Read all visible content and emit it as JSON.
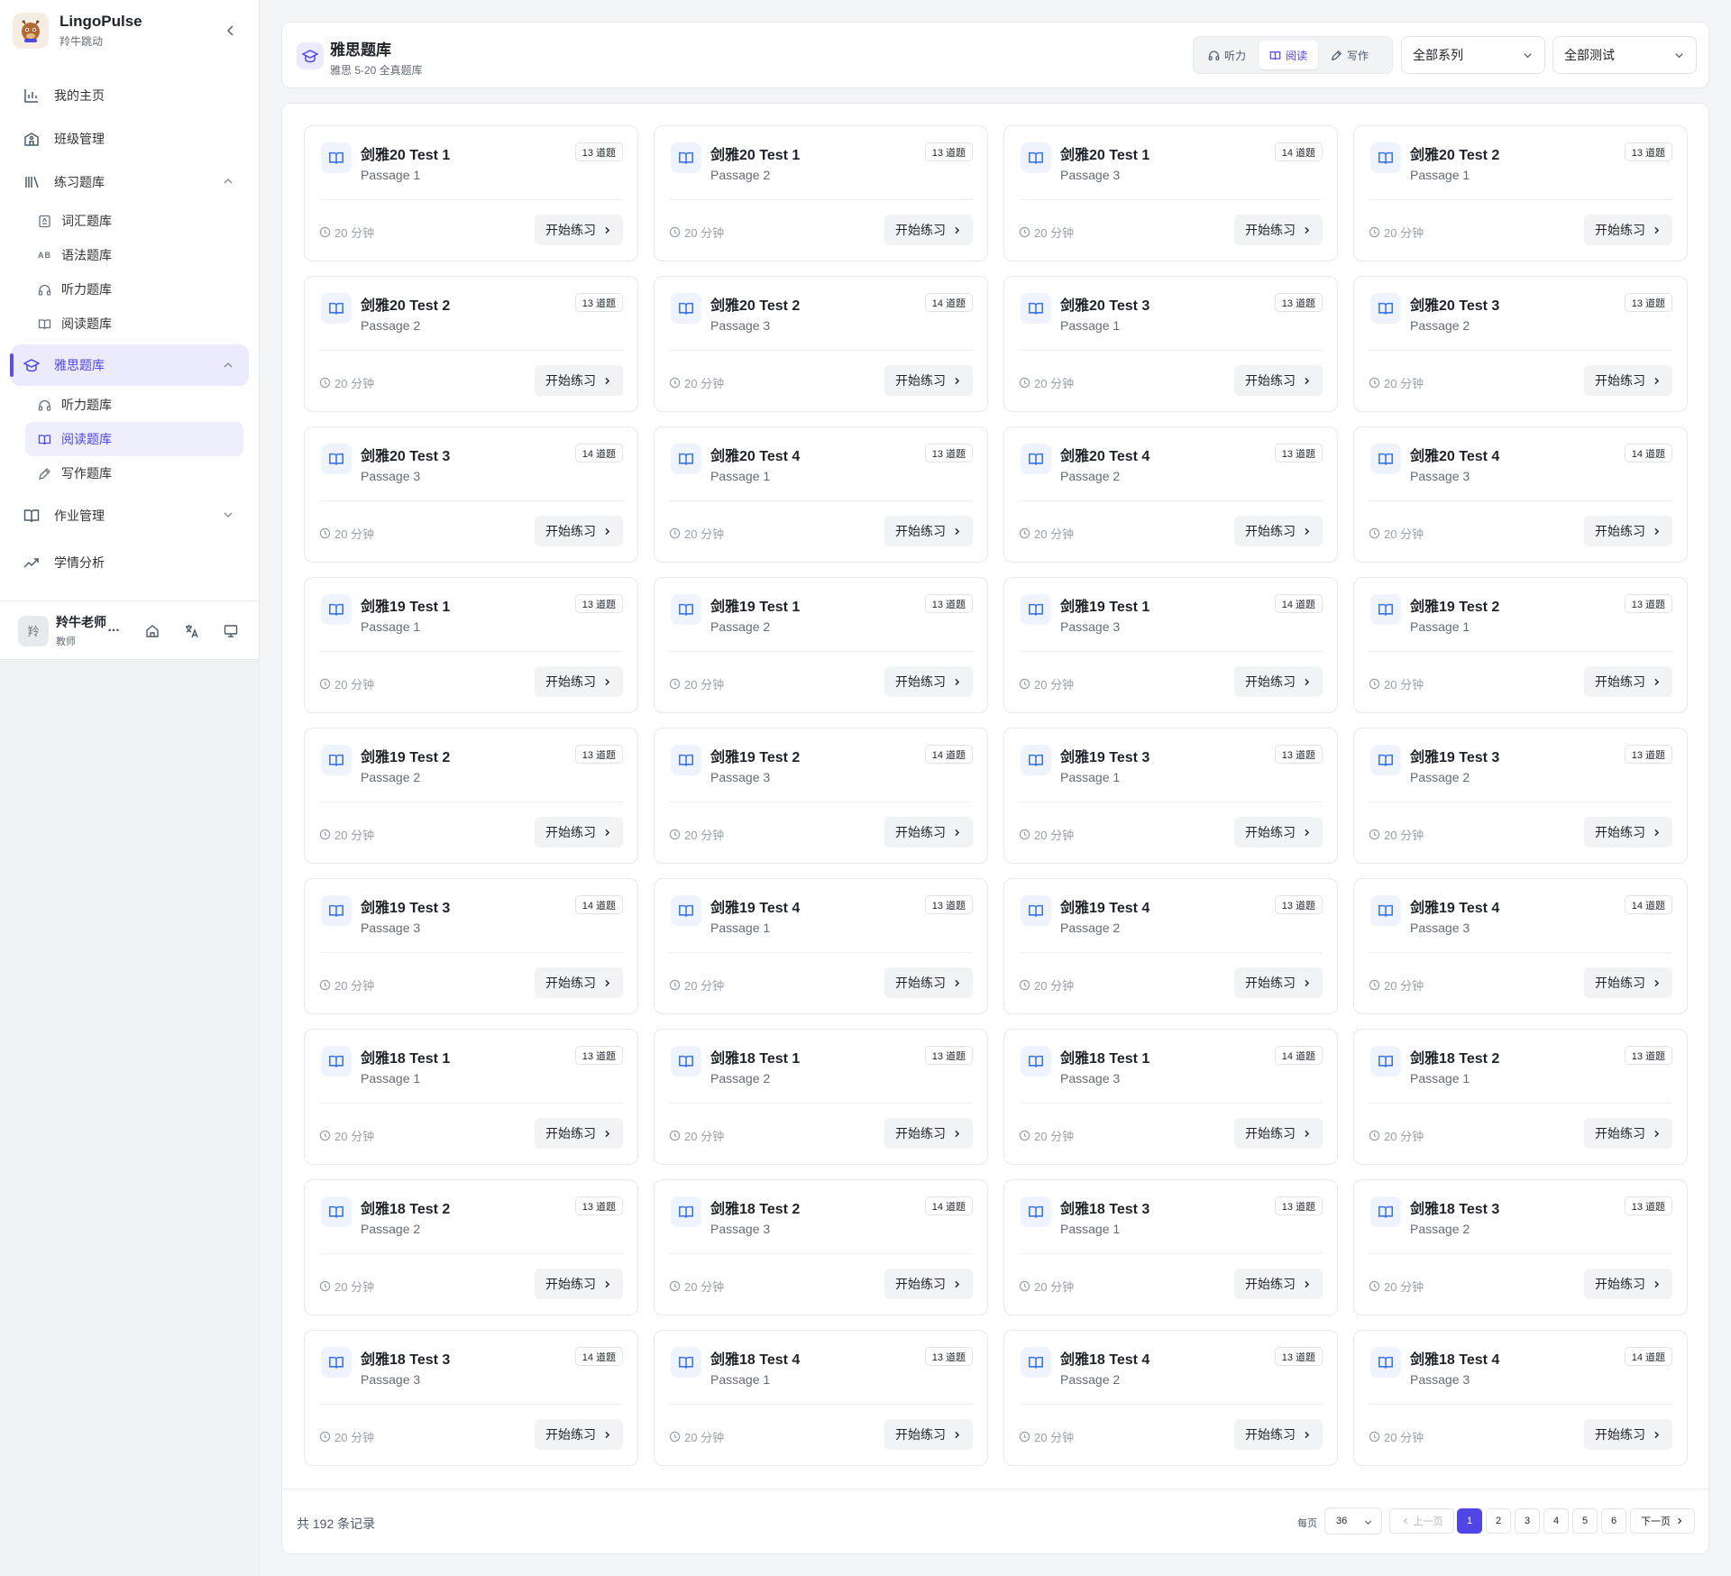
{
  "sidebar": {
    "brand_name": "LingoPulse",
    "brand_sub": "羚牛跳动",
    "nav": [
      {
        "label": "我的主页",
        "icon": "bar-chart-icon"
      },
      {
        "label": "班级管理",
        "icon": "school-icon"
      },
      {
        "label": "练习题库",
        "icon": "library-icon",
        "expanded": true,
        "children": [
          {
            "label": "词汇题库",
            "icon": "vocabulary-icon"
          },
          {
            "label": "语法题库",
            "icon": "ab-icon"
          },
          {
            "label": "听力题库",
            "icon": "headphones-icon"
          },
          {
            "label": "阅读题库",
            "icon": "book-open-icon"
          }
        ]
      },
      {
        "label": "雅思题库",
        "icon": "graduation-cap-icon",
        "expanded": true,
        "active": true,
        "children": [
          {
            "label": "听力题库",
            "icon": "headphones-icon"
          },
          {
            "label": "阅读题库",
            "icon": "book-open-icon",
            "active": true
          },
          {
            "label": "写作题库",
            "icon": "pen-icon"
          }
        ]
      },
      {
        "label": "作业管理",
        "icon": "book-icon",
        "expanded": false
      },
      {
        "label": "学情分析",
        "icon": "trend-up-icon"
      }
    ],
    "user": {
      "avatar_text": "羚",
      "name": "羚牛老师",
      "role": "教师",
      "more": "..."
    }
  },
  "header": {
    "title": "雅思题库",
    "subtitle": "雅思 5-20 全真题库",
    "tabs": [
      {
        "label": "听力",
        "icon": "headphones-icon"
      },
      {
        "label": "阅读",
        "icon": "book-open-icon",
        "active": true
      },
      {
        "label": "写作",
        "icon": "pen-icon"
      }
    ],
    "series_select": "全部系列",
    "test_select": "全部测试"
  },
  "cards": [
    {
      "title": "剑雅20 Test 1",
      "passage": "Passage 1",
      "count": "13 道题",
      "time": "20 分钟",
      "action": "开始练习"
    },
    {
      "title": "剑雅20 Test 1",
      "passage": "Passage 2",
      "count": "13 道题",
      "time": "20 分钟",
      "action": "开始练习"
    },
    {
      "title": "剑雅20 Test 1",
      "passage": "Passage 3",
      "count": "14 道题",
      "time": "20 分钟",
      "action": "开始练习"
    },
    {
      "title": "剑雅20 Test 2",
      "passage": "Passage 1",
      "count": "13 道题",
      "time": "20 分钟",
      "action": "开始练习"
    },
    {
      "title": "剑雅20 Test 2",
      "passage": "Passage 2",
      "count": "13 道题",
      "time": "20 分钟",
      "action": "开始练习"
    },
    {
      "title": "剑雅20 Test 2",
      "passage": "Passage 3",
      "count": "14 道题",
      "time": "20 分钟",
      "action": "开始练习"
    },
    {
      "title": "剑雅20 Test 3",
      "passage": "Passage 1",
      "count": "13 道题",
      "time": "20 分钟",
      "action": "开始练习"
    },
    {
      "title": "剑雅20 Test 3",
      "passage": "Passage 2",
      "count": "13 道题",
      "time": "20 分钟",
      "action": "开始练习"
    },
    {
      "title": "剑雅20 Test 3",
      "passage": "Passage 3",
      "count": "14 道题",
      "time": "20 分钟",
      "action": "开始练习"
    },
    {
      "title": "剑雅20 Test 4",
      "passage": "Passage 1",
      "count": "13 道题",
      "time": "20 分钟",
      "action": "开始练习"
    },
    {
      "title": "剑雅20 Test 4",
      "passage": "Passage 2",
      "count": "13 道题",
      "time": "20 分钟",
      "action": "开始练习"
    },
    {
      "title": "剑雅20 Test 4",
      "passage": "Passage 3",
      "count": "14 道题",
      "time": "20 分钟",
      "action": "开始练习"
    },
    {
      "title": "剑雅19 Test 1",
      "passage": "Passage 1",
      "count": "13 道题",
      "time": "20 分钟",
      "action": "开始练习"
    },
    {
      "title": "剑雅19 Test 1",
      "passage": "Passage 2",
      "count": "13 道题",
      "time": "20 分钟",
      "action": "开始练习"
    },
    {
      "title": "剑雅19 Test 1",
      "passage": "Passage 3",
      "count": "14 道题",
      "time": "20 分钟",
      "action": "开始练习"
    },
    {
      "title": "剑雅19 Test 2",
      "passage": "Passage 1",
      "count": "13 道题",
      "time": "20 分钟",
      "action": "开始练习"
    },
    {
      "title": "剑雅19 Test 2",
      "passage": "Passage 2",
      "count": "13 道题",
      "time": "20 分钟",
      "action": "开始练习"
    },
    {
      "title": "剑雅19 Test 2",
      "passage": "Passage 3",
      "count": "14 道题",
      "time": "20 分钟",
      "action": "开始练习"
    },
    {
      "title": "剑雅19 Test 3",
      "passage": "Passage 1",
      "count": "13 道题",
      "time": "20 分钟",
      "action": "开始练习"
    },
    {
      "title": "剑雅19 Test 3",
      "passage": "Passage 2",
      "count": "13 道题",
      "time": "20 分钟",
      "action": "开始练习"
    },
    {
      "title": "剑雅19 Test 3",
      "passage": "Passage 3",
      "count": "14 道题",
      "time": "20 分钟",
      "action": "开始练习"
    },
    {
      "title": "剑雅19 Test 4",
      "passage": "Passage 1",
      "count": "13 道题",
      "time": "20 分钟",
      "action": "开始练习"
    },
    {
      "title": "剑雅19 Test 4",
      "passage": "Passage 2",
      "count": "13 道题",
      "time": "20 分钟",
      "action": "开始练习"
    },
    {
      "title": "剑雅19 Test 4",
      "passage": "Passage 3",
      "count": "14 道题",
      "time": "20 分钟",
      "action": "开始练习"
    },
    {
      "title": "剑雅18 Test 1",
      "passage": "Passage 1",
      "count": "13 道题",
      "time": "20 分钟",
      "action": "开始练习"
    },
    {
      "title": "剑雅18 Test 1",
      "passage": "Passage 2",
      "count": "13 道题",
      "time": "20 分钟",
      "action": "开始练习"
    },
    {
      "title": "剑雅18 Test 1",
      "passage": "Passage 3",
      "count": "14 道题",
      "time": "20 分钟",
      "action": "开始练习"
    },
    {
      "title": "剑雅18 Test 2",
      "passage": "Passage 1",
      "count": "13 道题",
      "time": "20 分钟",
      "action": "开始练习"
    },
    {
      "title": "剑雅18 Test 2",
      "passage": "Passage 2",
      "count": "13 道题",
      "time": "20 分钟",
      "action": "开始练习"
    },
    {
      "title": "剑雅18 Test 2",
      "passage": "Passage 3",
      "count": "14 道题",
      "time": "20 分钟",
      "action": "开始练习"
    },
    {
      "title": "剑雅18 Test 3",
      "passage": "Passage 1",
      "count": "13 道题",
      "time": "20 分钟",
      "action": "开始练习"
    },
    {
      "title": "剑雅18 Test 3",
      "passage": "Passage 2",
      "count": "13 道题",
      "time": "20 分钟",
      "action": "开始练习"
    },
    {
      "title": "剑雅18 Test 3",
      "passage": "Passage 3",
      "count": "14 道题",
      "time": "20 分钟",
      "action": "开始练习"
    },
    {
      "title": "剑雅18 Test 4",
      "passage": "Passage 1",
      "count": "13 道题",
      "time": "20 分钟",
      "action": "开始练习"
    },
    {
      "title": "剑雅18 Test 4",
      "passage": "Passage 2",
      "count": "13 道题",
      "time": "20 分钟",
      "action": "开始练习"
    },
    {
      "title": "剑雅18 Test 4",
      "passage": "Passage 3",
      "count": "14 道题",
      "time": "20 分钟",
      "action": "开始练习"
    }
  ],
  "pagination": {
    "total_text": "共 192 条记录",
    "per_page_label": "每页",
    "per_page": "36",
    "prev": "上一页",
    "next": "下一页",
    "pages": [
      "1",
      "2",
      "3",
      "4",
      "5",
      "6"
    ],
    "current": "1"
  },
  "colors": {
    "accent": "#4f46e5",
    "card_icon": "#3b74e6"
  }
}
